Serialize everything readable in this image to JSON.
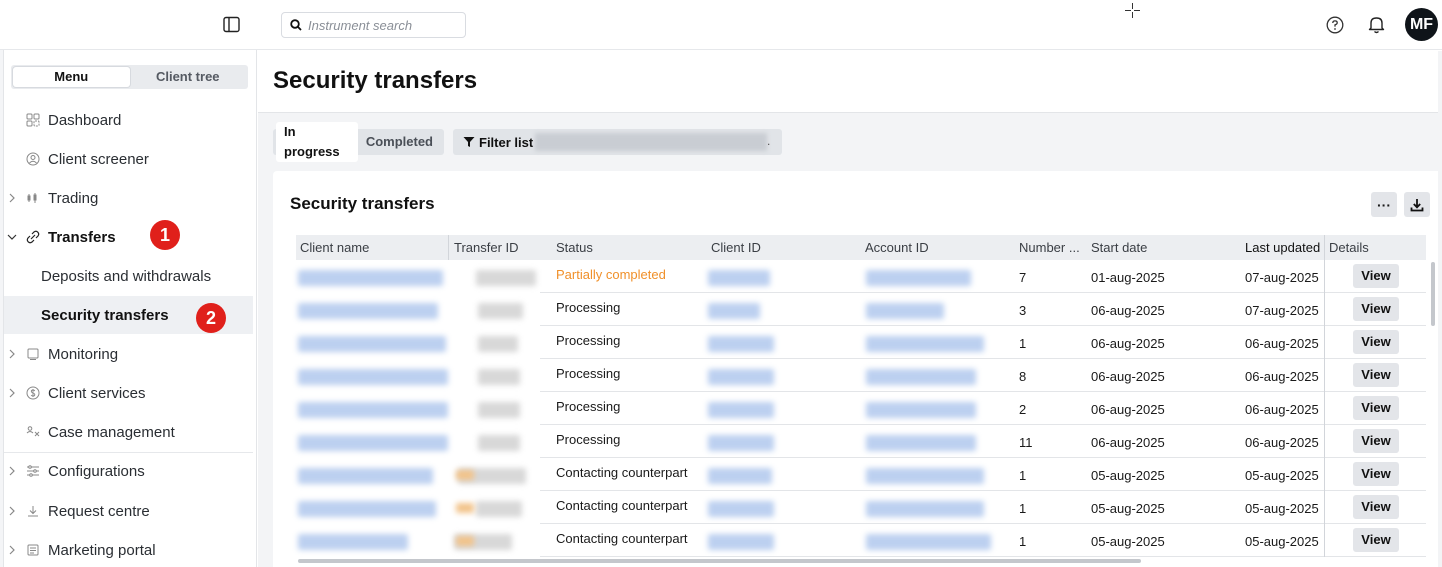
{
  "topbar": {
    "search_placeholder": "Instrument search",
    "avatar_initials": "MF"
  },
  "sidebar": {
    "tabs": [
      {
        "label": "Menu",
        "active": true
      },
      {
        "label": "Client tree",
        "active": false
      }
    ],
    "items": [
      {
        "label": "Dashboard",
        "icon": "dashboard-icon"
      },
      {
        "label": "Client screener",
        "icon": "user-circle-icon"
      },
      {
        "label": "Trading",
        "icon": "trading-icon",
        "expandable": true
      },
      {
        "label": "Transfers",
        "icon": "transfer-icon",
        "expandable": true,
        "expanded": true
      },
      {
        "label": "Deposits and withdrawals",
        "sub": true
      },
      {
        "label": "Security transfers",
        "sub": true,
        "selected": true
      },
      {
        "label": "Monitoring",
        "icon": "monitor-icon",
        "expandable": true
      },
      {
        "label": "Client services",
        "icon": "dollar-circle-icon",
        "expandable": true
      },
      {
        "label": "Case management",
        "icon": "case-icon"
      },
      {
        "label": "Configurations",
        "icon": "sliders-icon",
        "expandable": true
      },
      {
        "label": "Request centre",
        "icon": "download-icon",
        "expandable": true
      },
      {
        "label": "Marketing portal",
        "icon": "portal-icon",
        "expandable": true
      }
    ],
    "annotations": [
      "1",
      "2"
    ]
  },
  "page": {
    "title": "Security transfers",
    "status_tabs": [
      {
        "label": "In progress",
        "active": true
      },
      {
        "label": "Completed",
        "active": false
      }
    ],
    "filter_label": "Filter list",
    "filter_suffix": "."
  },
  "card": {
    "title": "Security transfers",
    "more_label": "···"
  },
  "table": {
    "columns": [
      "Client name",
      "Transfer ID",
      "Status",
      "Client ID",
      "Account ID",
      "Number ...",
      "Start date",
      "Last updated",
      "Details"
    ],
    "rows": [
      {
        "status": "Partially completed",
        "number": "7",
        "start": "01-aug-2025",
        "updated": "07-aug-2025",
        "details": "View"
      },
      {
        "status": "Processing",
        "number": "3",
        "start": "06-aug-2025",
        "updated": "07-aug-2025",
        "details": "View"
      },
      {
        "status": "Processing",
        "number": "1",
        "start": "06-aug-2025",
        "updated": "06-aug-2025",
        "details": "View"
      },
      {
        "status": "Processing",
        "number": "8",
        "start": "06-aug-2025",
        "updated": "06-aug-2025",
        "details": "View"
      },
      {
        "status": "Processing",
        "number": "2",
        "start": "06-aug-2025",
        "updated": "06-aug-2025",
        "details": "View"
      },
      {
        "status": "Processing",
        "number": "11",
        "start": "06-aug-2025",
        "updated": "06-aug-2025",
        "details": "View"
      },
      {
        "status": "Contacting counterpart",
        "number": "1",
        "start": "05-aug-2025",
        "updated": "05-aug-2025",
        "details": "View"
      },
      {
        "status": "Contacting counterpart",
        "number": "1",
        "start": "05-aug-2025",
        "updated": "05-aug-2025",
        "details": "View"
      },
      {
        "status": "Contacting counterpart",
        "number": "1",
        "start": "05-aug-2025",
        "updated": "05-aug-2025",
        "details": "View"
      }
    ]
  },
  "colors": {
    "badge": "#e0201b",
    "partial_status": "#f0902a",
    "avatar_bg": "#0f1419"
  }
}
